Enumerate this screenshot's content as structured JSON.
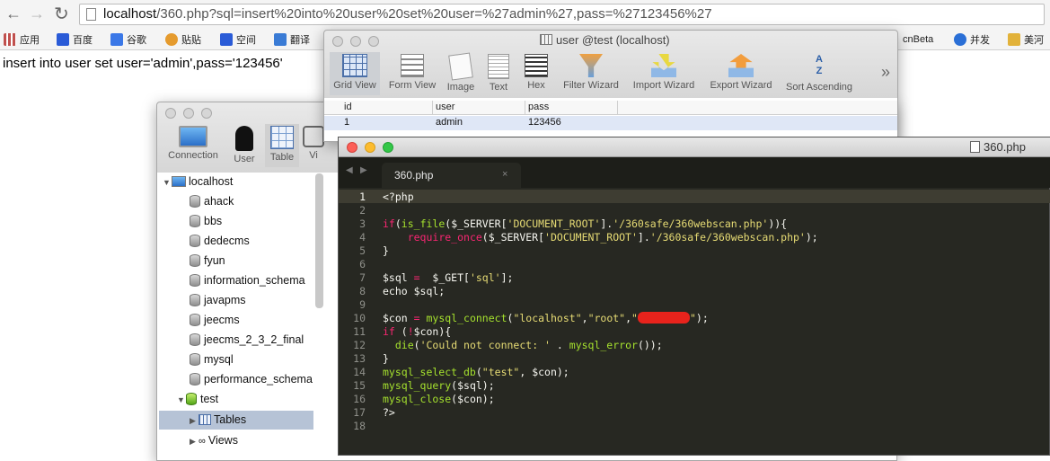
{
  "browser": {
    "url_host": "localhost",
    "url_rest": "/360.php?sql=insert%20into%20user%20set%20user=%27admin%27,pass=%27123456%27",
    "bookmarks": [
      {
        "label": "应用",
        "icon": "apps-grid-icon",
        "color": "#c0504d"
      },
      {
        "label": "百度",
        "icon": "baidu-paw-icon",
        "color": "#2a5bd7"
      },
      {
        "label": "谷歌",
        "icon": "google-icon",
        "color": "#3b78e7"
      },
      {
        "label": "贴贴",
        "icon": "tieba-icon",
        "color": "#e59b2e"
      },
      {
        "label": "空间",
        "icon": "qzone-icon",
        "color": "#2a5bd7"
      },
      {
        "label": "翻译",
        "icon": "translate-icon",
        "color": "#3a7bd5"
      },
      {
        "label": "cnBeta",
        "icon": "cnbeta-icon",
        "color": "#555555"
      },
      {
        "label": "并发",
        "icon": "gear-icon",
        "color": "#2a6fd6"
      },
      {
        "label": "美河",
        "icon": "meihe-icon",
        "color": "#e2b23a"
      }
    ]
  },
  "page": {
    "output_text": "insert into user set user='admin',pass='123456'"
  },
  "user_window": {
    "title": "user @test (localhost)",
    "toolbar": [
      "Grid View",
      "Form View",
      "Image",
      "Text",
      "Hex",
      "Filter Wizard",
      "Import Wizard",
      "Export Wizard",
      "Sort Ascending"
    ],
    "overflow": "»",
    "columns": [
      "id",
      "user",
      "pass"
    ],
    "rows": [
      [
        "1",
        "admin",
        "123456"
      ]
    ]
  },
  "navicat": {
    "toolbar": [
      "Connection",
      "User",
      "Table",
      "Vi"
    ],
    "connection": "localhost",
    "databases": [
      "ahack",
      "bbs",
      "dedecms",
      "fyun",
      "information_schema",
      "javapms",
      "jeecms",
      "jeecms_2_3_2_final",
      "mysql",
      "performance_schema"
    ],
    "open_db": "test",
    "open_children": [
      "Tables",
      "Views"
    ]
  },
  "editor": {
    "window_title": "360.php",
    "tab_label": "360.php",
    "tab_close": "×",
    "line_numbers": [
      "1",
      "2",
      "3",
      "4",
      "5",
      "6",
      "7",
      "8",
      "9",
      "10",
      "11",
      "12",
      "13",
      "14",
      "15",
      "16",
      "17",
      "18"
    ],
    "code": {
      "l1": "<?php",
      "l3_if": "if",
      "l3_fn": "is_file",
      "l3_a": "($_SERVER[",
      "l3_s1": "'DOCUMENT_ROOT'",
      "l3_b": "].",
      "l3_s2": "'/360safe/360webscan.php'",
      "l3_c": ")){",
      "l4_kw": "require_once",
      "l4_a": "($_SERVER[",
      "l4_s1": "'DOCUMENT_ROOT'",
      "l4_b": "].",
      "l4_s2": "'/360safe/360webscan.php'",
      "l4_c": ");",
      "l5": "}",
      "l7_a": "$sql ",
      "l7_eq": "=",
      "l7_b": "  $_GET[",
      "l7_s": "'sql'",
      "l7_c": "];",
      "l8": "echo $sql;",
      "l10_a": "$con ",
      "l10_eq": "=",
      "l10_fn": "mysql_connect",
      "l10_b": "(",
      "l10_s1": "\"localhost\"",
      "l10_c": ",",
      "l10_s2": "\"root\"",
      "l10_d": ",",
      "l10_s3a": "\"",
      "l10_s3b": "\"",
      "l10_e": ");",
      "l11_kw": "if",
      "l11_a": " (",
      "l11_not": "!",
      "l11_b": "$con){",
      "l12_fn": "die",
      "l12_a": "(",
      "l12_s": "'Could not connect: '",
      "l12_b": " . ",
      "l12_fn2": "mysql_error",
      "l12_c": "());",
      "l13": "}",
      "l14_fn": "mysql_select_db",
      "l14_a": "(",
      "l14_s": "\"test\"",
      "l14_b": ", $con);",
      "l15_fn": "mysql_query",
      "l15_a": "($sql);",
      "l16_fn": "mysql_close",
      "l16_a": "($con);",
      "l17": "?>"
    }
  }
}
